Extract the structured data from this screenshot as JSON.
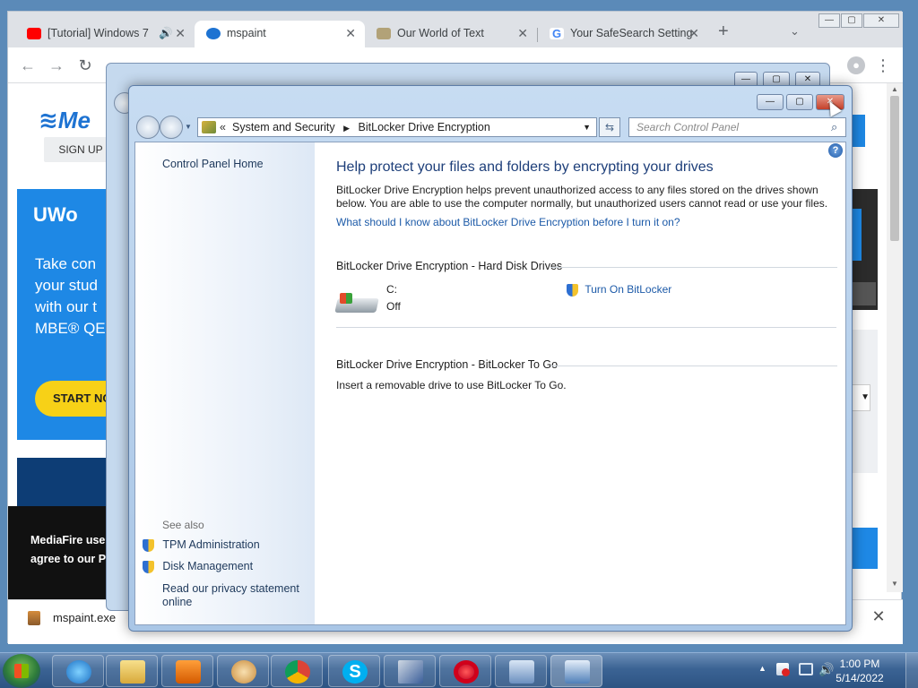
{
  "chrome": {
    "tabs": [
      {
        "title": "[Tutorial] Windows 7",
        "favicon": "youtube-icon",
        "color": "#ff0000"
      },
      {
        "title": "mspaint",
        "favicon": "mediafire-icon",
        "color": "#1e73d2"
      },
      {
        "title": "Our World of Text",
        "favicon": "world-icon",
        "color": "#b2a278"
      },
      {
        "title": "Your SafeSearch Setting",
        "favicon": "google-icon",
        "color": "#4285f4"
      }
    ],
    "new_tab_symbol": "+",
    "mediafire_logo": "Me",
    "signup": "SIGN UP",
    "uw_logo": "UWo",
    "promo_lines": [
      "Take con",
      "your stud",
      "with our t",
      "MBE® QE"
    ],
    "start_now": "START NO",
    "cookie_lines": [
      "MediaFire use",
      "agree to our Pr"
    ],
    "download_name": "mspaint.exe"
  },
  "control_panel": {
    "breadcrumb": [
      "System and Security",
      "BitLocker Drive Encryption"
    ],
    "breadcrumb_prefix": "«",
    "search_placeholder": "Search Control Panel",
    "left": {
      "home": "Control Panel Home",
      "see_also": "See also",
      "links": [
        "TPM Administration",
        "Disk Management"
      ],
      "privacy_line1": "Read our privacy statement",
      "privacy_line2": "online"
    },
    "main": {
      "heading": "Help protect your files and folders by encrypting your drives",
      "desc_line1": "BitLocker Drive Encryption helps prevent unauthorized access to any files stored on the drives shown",
      "desc_line2": "below. You are able to use the computer normally, but unauthorized users cannot read or use your files.",
      "faq_link": "What should I know about BitLocker Drive Encryption before I turn it on?",
      "hdd_section": "BitLocker Drive Encryption - Hard Disk Drives",
      "drive_label": "C:",
      "drive_status": "Off",
      "turn_on": "Turn On BitLocker",
      "togo_section": "BitLocker Drive Encryption - BitLocker To Go",
      "togo_text": "Insert a removable drive to use BitLocker To Go."
    }
  },
  "taskbar": {
    "apps": [
      "internet-explorer",
      "windows-explorer",
      "media-player",
      "paint",
      "chrome",
      "skype",
      "mspaint-installer",
      "opera",
      "control-panel-a",
      "control-panel-b"
    ],
    "time": "1:00 PM",
    "date": "5/14/2022"
  }
}
